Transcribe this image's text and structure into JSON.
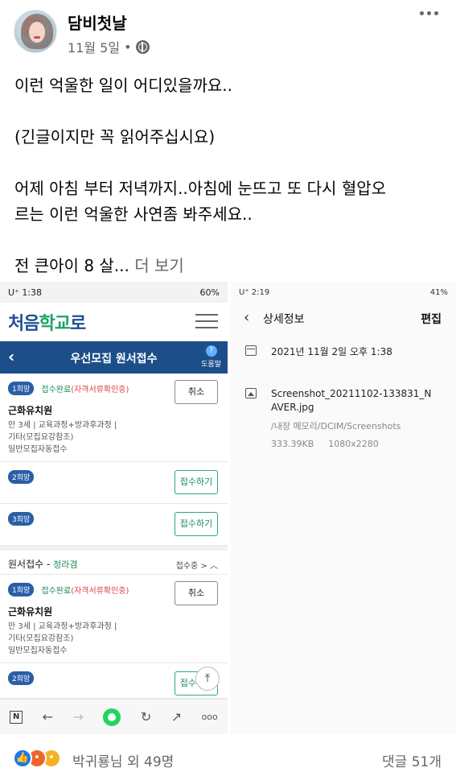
{
  "post": {
    "author": "담비첫날",
    "date": "11월 5일",
    "dot": "•",
    "text": [
      "이런 억울한 일이 어디있을까요..",
      "(긴글이지만 꼭 읽어주십시요)",
      "어제 아침 부터 저녁까지..아침에 눈뜨고 또 다시 혈압오르는 이런 억울한 사연좀 봐주세요..",
      "전 큰아이 8 살..."
    ],
    "see_more": "더 보기"
  },
  "left_shot": {
    "status_time": "U⁺ 1:38",
    "status_right": "60%",
    "logo_a": "처음",
    "logo_b": "학교",
    "logo_c": "로",
    "nav_title": "우선모집 원서접수",
    "back": "‹",
    "help_q": "?",
    "help_label": "도움말",
    "rows": [
      {
        "badge": "1희망",
        "status_main": "접수완료",
        "status_note": "(자격서류확인중)",
        "school": "근화유치원",
        "line1": "만 3세 | 교육과정+방과후과정 |",
        "line2": "기타(모집요강참조)",
        "line3": "일반모집자동접수",
        "button": "취소"
      },
      {
        "badge": "2희망",
        "button": "접수하기"
      },
      {
        "badge": "3희망",
        "button": "접수하기"
      }
    ],
    "section": {
      "title": "원서접수 - ",
      "name": "정라겸",
      "state": "접수중 >  ︿"
    },
    "rows2": [
      {
        "badge": "1희망",
        "status_main": "접수완료",
        "status_note": "(자격서류확인중)",
        "school": "근화유치원",
        "line1": "만 3세 | 교육과정+방과후과정 |",
        "line2": "기타(모집요강참조)",
        "line3": "일반모집자동접수",
        "button": "취소"
      },
      {
        "badge": "2희망",
        "button": "접수하기"
      }
    ],
    "scroll_top": "⤒",
    "browser": {
      "n": "N",
      "back": "←",
      "forward": "→",
      "reload": "↻",
      "share": "↗",
      "more": "ooo"
    }
  },
  "right_shot": {
    "status_time": "U⁺ 2:19",
    "status_right": "41%",
    "back": "‹",
    "title": "상세정보",
    "edit": "편집",
    "datetime": "2021년 11월 2일 오후 1:38",
    "filename": "Screenshot_20211102-133831_NAVER.jpg",
    "path": "/내장 메모리/DCIM/Screenshots",
    "size": "333.39KB",
    "resolution": "1080x2280"
  },
  "footer": {
    "reaction_text": "박귀룡님 외 49명",
    "comments": "댓글 51개"
  },
  "colors": {
    "brand_blue": "#1c4f8a",
    "like_blue": "#1877f2",
    "meta_gray": "#65676b"
  }
}
